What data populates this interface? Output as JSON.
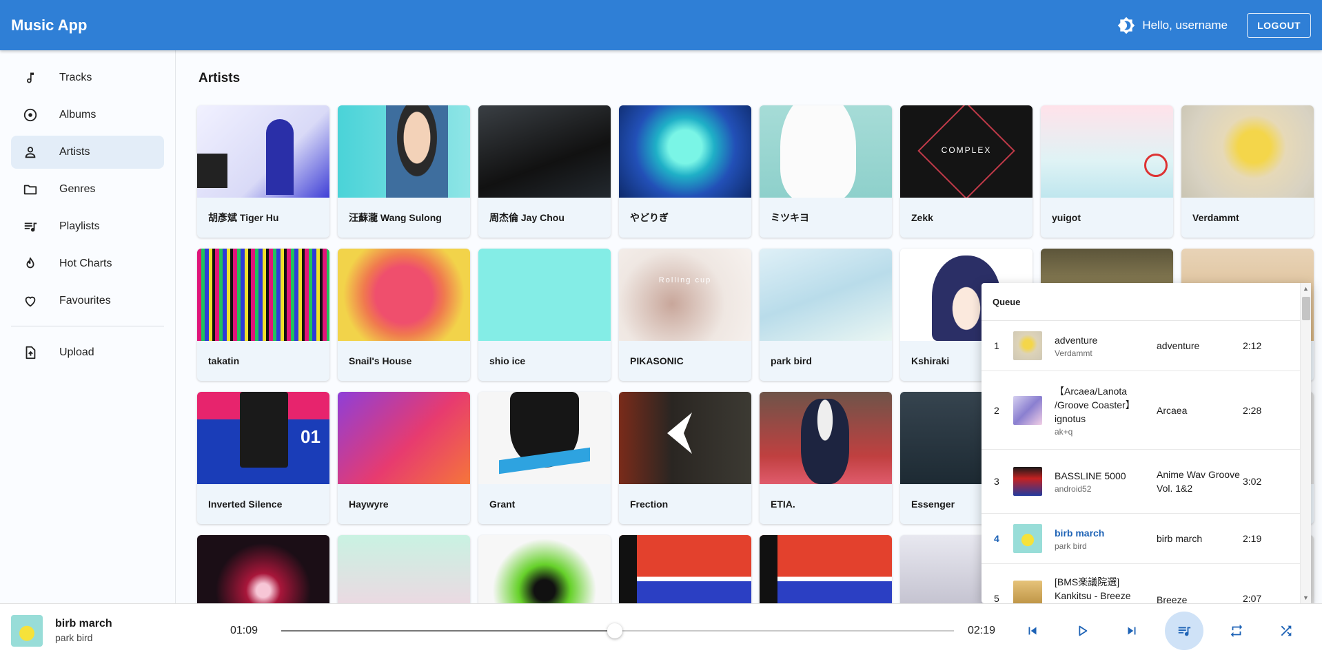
{
  "app": {
    "title": "Music App",
    "greeting": "Hello, username",
    "logout_label": "LOGOUT"
  },
  "sidebar": {
    "items": [
      {
        "label": "Tracks",
        "icon": "music-note-icon"
      },
      {
        "label": "Albums",
        "icon": "album-icon"
      },
      {
        "label": "Artists",
        "icon": "person-icon",
        "active": true
      },
      {
        "label": "Genres",
        "icon": "folder-icon"
      },
      {
        "label": "Playlists",
        "icon": "playlist-icon"
      },
      {
        "label": "Hot Charts",
        "icon": "flame-icon"
      },
      {
        "label": "Favourites",
        "icon": "heart-icon"
      }
    ],
    "upload_label": "Upload"
  },
  "main": {
    "title": "Artists",
    "artists": [
      "胡彥斌 Tiger Hu",
      "汪蘇瀧 Wang Sulong",
      "周杰倫 Jay Chou",
      "やどりぎ",
      "ミツキヨ",
      "Zekk",
      "yuigot",
      "Verdammt",
      "takatin",
      "Snail's House",
      "shio ice",
      "PIKASONIC",
      "park bird",
      "Kshiraki",
      "",
      "",
      "Inverted Silence",
      "Haywyre",
      "Grant",
      "Frection",
      "ETIA.",
      "Essenger",
      "",
      "",
      "",
      "",
      "",
      "",
      "",
      "",
      "",
      ""
    ]
  },
  "queue": {
    "title": "Queue",
    "rows": [
      {
        "num": "1",
        "title": "adventure",
        "artist": "Verdammt",
        "album": "adventure",
        "duration": "2:12"
      },
      {
        "num": "2",
        "title": "【Arcaea/Lanota /Groove Coaster】 ignotus",
        "artist": "ak+q",
        "album": "Arcaea",
        "duration": "2:28"
      },
      {
        "num": "3",
        "title": "BASSLINE 5000",
        "artist": "android52",
        "album": "Anime Wav Groove Vol. 1&2",
        "duration": "3:02"
      },
      {
        "num": "4",
        "title": "birb march",
        "artist": "park bird",
        "album": "birb march",
        "duration": "2:19",
        "current": true
      },
      {
        "num": "5",
        "title": "[BMS楽議院選] Kankitsu - Breeze",
        "artist": "",
        "album": "Breeze",
        "duration": "2:07"
      }
    ]
  },
  "player": {
    "title": "birb march",
    "artist": "park bird",
    "elapsed": "01:09",
    "total": "02:19",
    "progress": 0.496
  },
  "colors": {
    "accent": "#2f7fd6",
    "active_nav": "#e3edf8",
    "current_track": "#1e63b6"
  }
}
